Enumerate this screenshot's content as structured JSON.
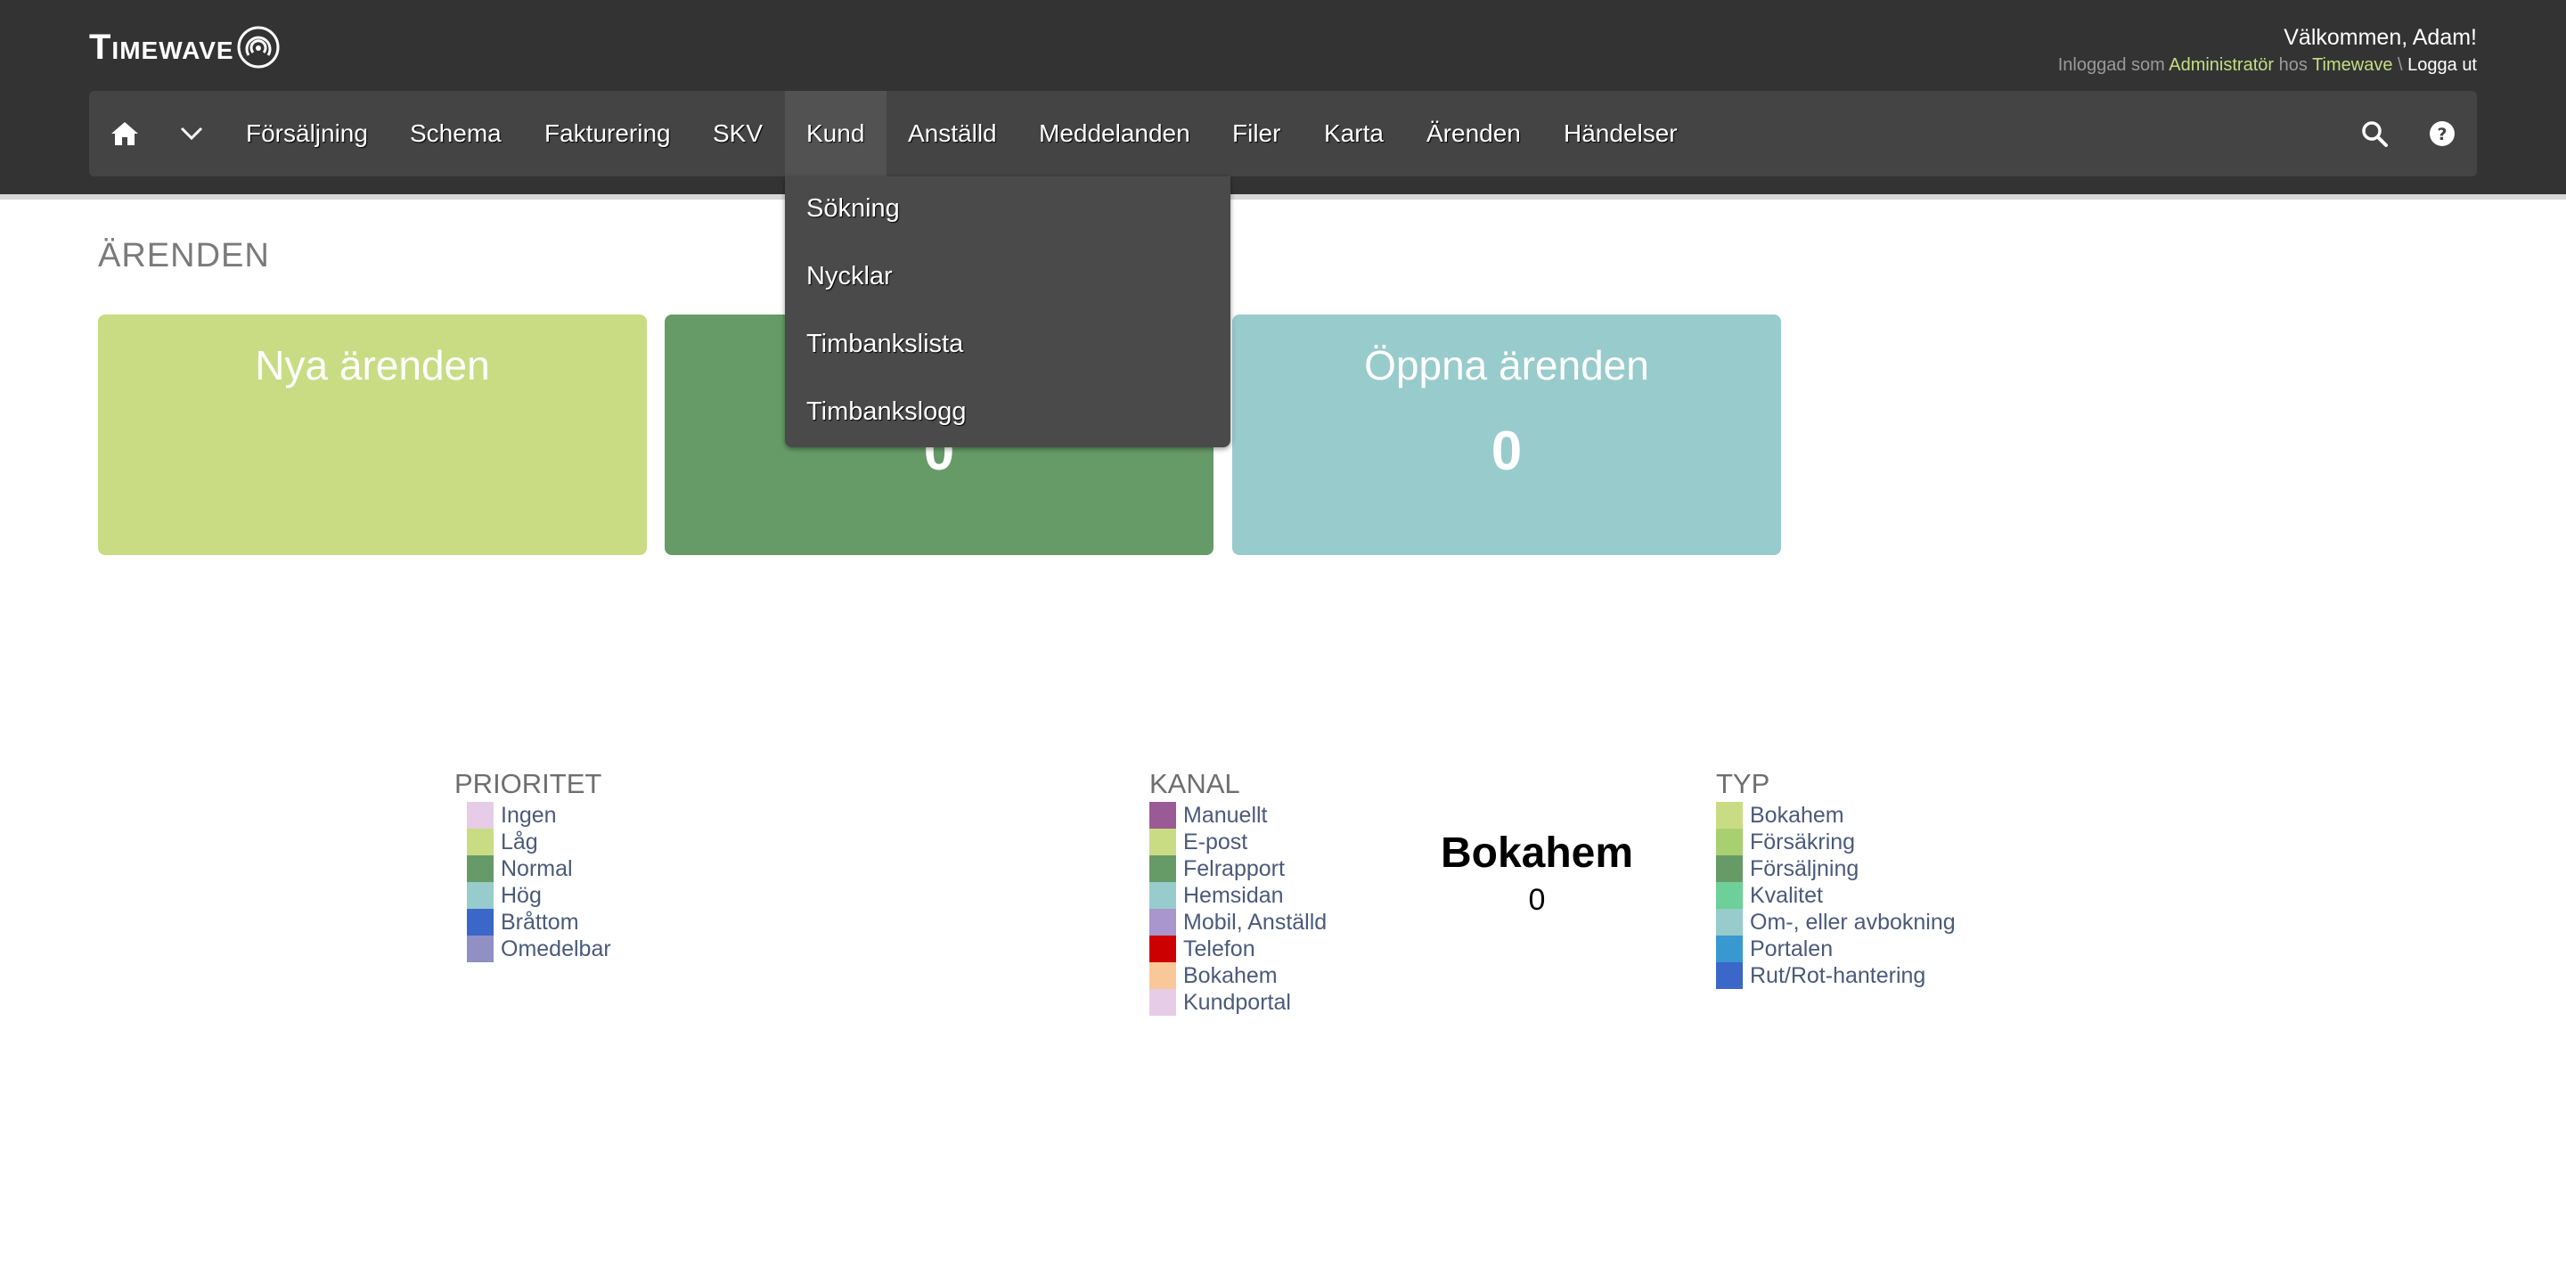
{
  "header": {
    "logo_text": "Timewave",
    "welcome": "Välkommen, Adam!",
    "login": {
      "prefix": "Inloggad som",
      "role": "Administratör",
      "middle": "hos",
      "company": "Timewave",
      "separator": "\\",
      "logout": "Logga ut"
    }
  },
  "nav": {
    "items": [
      "Försäljning",
      "Schema",
      "Fakturering",
      "SKV",
      "Kund",
      "Anställd",
      "Meddelanden",
      "Filer",
      "Karta",
      "Ärenden",
      "Händelser"
    ],
    "active": "Kund",
    "icons": [
      "home-icon",
      "chevron-down-icon",
      "search-icon",
      "help-icon"
    ]
  },
  "dropdown": {
    "items": [
      "Sökning",
      "Nycklar",
      "Timbankslista",
      "Timbankslogg"
    ]
  },
  "page": {
    "title": "ÄRENDEN"
  },
  "cards": [
    {
      "title": "Nya ärenden",
      "value": "",
      "color": "#c9dc84"
    },
    {
      "title": "",
      "value": "0",
      "color": "#669b68"
    },
    {
      "title": "Öppna ärenden",
      "value": "0",
      "color": "#98cbcc"
    }
  ],
  "legends": {
    "prioritet": {
      "title": "PRIORITET",
      "items": [
        {
          "label": "Ingen",
          "color": "#e6cce6"
        },
        {
          "label": "Låg",
          "color": "#c9dc84"
        },
        {
          "label": "Normal",
          "color": "#669b68"
        },
        {
          "label": "Hög",
          "color": "#98cbcc"
        },
        {
          "label": "Bråttom",
          "color": "#3b67c9"
        },
        {
          "label": "Omedelbar",
          "color": "#9090c4"
        }
      ]
    },
    "kanal": {
      "title": "KANAL",
      "items": [
        {
          "label": "Manuellt",
          "color": "#9a5a96"
        },
        {
          "label": "E-post",
          "color": "#c9dc84"
        },
        {
          "label": "Felrapport",
          "color": "#669b68"
        },
        {
          "label": "Hemsidan",
          "color": "#98cbcc"
        },
        {
          "label": "Mobil, Anställd",
          "color": "#a896cc"
        },
        {
          "label": "Telefon",
          "color": "#cc0000"
        },
        {
          "label": "Bokahem",
          "color": "#f8c898"
        },
        {
          "label": "Kundportal",
          "color": "#e6cce6"
        }
      ]
    },
    "typ": {
      "title": "TYP",
      "items": [
        {
          "label": "Bokahem",
          "color": "#c9dc84"
        },
        {
          "label": "Försäkring",
          "color": "#a8d070"
        },
        {
          "label": "Försäljning",
          "color": "#669b68"
        },
        {
          "label": "Kvalitet",
          "color": "#6cd098"
        },
        {
          "label": "Om-, eller avbokning",
          "color": "#98cbcc"
        },
        {
          "label": "Portalen",
          "color": "#3898d0"
        },
        {
          "label": "Rut/Rot-hantering",
          "color": "#3b67c9"
        }
      ]
    }
  },
  "center_stat": {
    "name": "Bokahem",
    "value": "0"
  }
}
